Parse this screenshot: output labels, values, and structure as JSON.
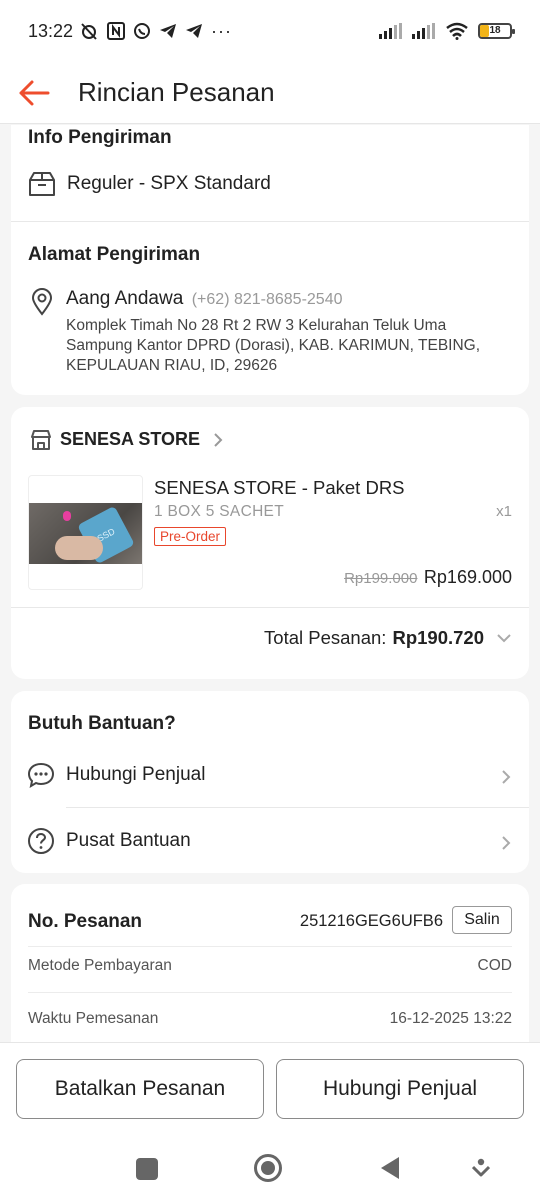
{
  "status_bar": {
    "time": "13:22",
    "battery": "18"
  },
  "header": {
    "title": "Rincian Pesanan"
  },
  "shipping": {
    "info_title": "Info Pengiriman",
    "method": "Reguler - SPX Standard",
    "address_title": "Alamat Pengiriman",
    "name": "Aang Andawa",
    "phone": "(+62) 821-8685-2540",
    "address_line1": "Komplek Timah No 28 Rt 2 RW 3 Kelurahan Teluk Uma",
    "address_line2": "Sampung Kantor DPRD (Dorasi), KAB. KARIMUN, TEBING,",
    "address_line3": "KEPULAUAN RIAU, ID, 29626"
  },
  "store": {
    "name": "SENESA STORE",
    "product_name": "SENESA STORE - Paket DRS",
    "variant": "1 BOX 5 SACHET",
    "quantity": "x1",
    "badge": "Pre-Order",
    "thumbnail_label": "SSD",
    "original_price": "Rp199.000",
    "price": "Rp169.000",
    "total_label": "Total Pesanan:",
    "total_value": "Rp190.720"
  },
  "help": {
    "title": "Butuh Bantuan?",
    "contact_seller": "Hubungi Penjual",
    "help_center": "Pusat Bantuan"
  },
  "order": {
    "number_label": "No. Pesanan",
    "number_value": "251216GEG6UFB6",
    "copy_label": "Salin",
    "payment_label": "Metode Pembayaran",
    "payment_value": "COD",
    "time_label": "Waktu Pemesanan",
    "time_value": "16-12-2025 13:22"
  },
  "actions": {
    "cancel": "Batalkan Pesanan",
    "contact": "Hubungi Penjual"
  },
  "colors": {
    "accent": "#ee4d2d",
    "badge": "#e8462c"
  }
}
